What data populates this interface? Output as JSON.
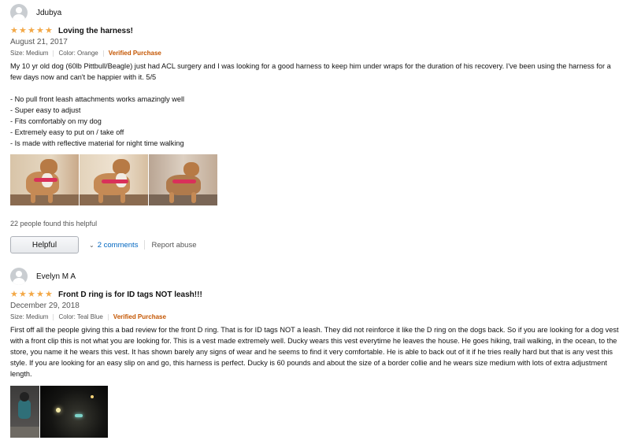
{
  "reviews": [
    {
      "profile_name": "Jdubya",
      "stars": "★★★★★",
      "title": "Loving the harness!",
      "date": "August 21, 2017",
      "size": "Size: Medium",
      "color": "Color: Orange",
      "verified": "Verified Purchase",
      "body": "My 10 yr old dog (60lb Pittbull/Beagle) just had ACL surgery and I was looking for a good harness to keep him under wraps for the duration of his recovery. I've been using the harness for a few days now and can't be happier with it. 5/5",
      "bullets": [
        "- No pull front leash attachments works amazingly well",
        "- Super easy to adjust",
        "- Fits comfortably on my dog",
        "- Extremely easy to put on / take off",
        "- Is made with reflective material for night time walking"
      ],
      "helpful_count": "22 people found this helpful",
      "helpful_button": "Helpful",
      "comments": "2 comments",
      "report": "Report abuse"
    },
    {
      "profile_name": "Evelyn M A",
      "stars": "★★★★★",
      "title": "Front D ring is for ID tags NOT leash!!!",
      "date": "December 29, 2018",
      "size": "Size: Medium",
      "color": "Color: Teal Blue",
      "verified": "Verified Purchase",
      "body": "First off all the people giving this a bad review for the front D ring. That is for ID tags NOT a leash. They did not reinforce it like the D ring on the dogs back. So if you are looking for a dog vest with a front clip this is not what you are looking for. This is a vest made extremely well. Ducky wears this vest everytime he leaves the house. He goes hiking, trail walking, in the ocean, to the store, you name it he wears this vest. It has shown barely any signs of wear and he seems to find it very comfortable. He is able to back out of it if he tries really hard but that is any vest this style. If you are looking for an easy slip on and go, this harness is perfect. Ducky is 60 pounds and about the size of a border collie and he wears size medium with lots of extra adjustment length."
    }
  ],
  "colors": {
    "star": "#f3a847",
    "verified": "#c45500",
    "link": "#0066c0"
  },
  "icons": {
    "avatar": "default-profile-avatar",
    "chevron": "chevron-down-icon",
    "star": "star-icon"
  }
}
